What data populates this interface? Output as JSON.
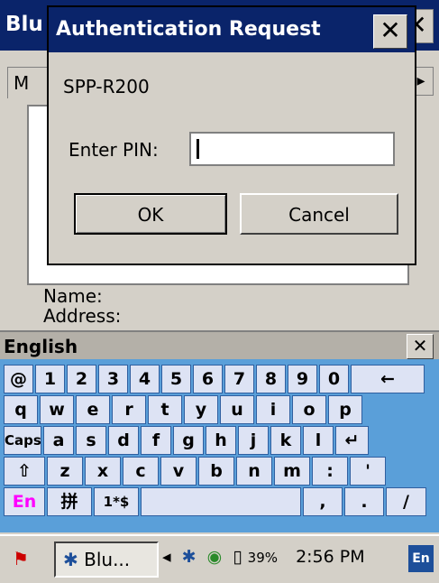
{
  "background_window": {
    "title": "Blu",
    "tab_label": "M",
    "scroll_arrow": "▸",
    "name_label": "Name:",
    "address_label": "Address:"
  },
  "dialog": {
    "title": "Authentication Request",
    "close_glyph": "✕",
    "device_name": "SPP-R200",
    "pin_label": "Enter PIN:",
    "pin_value": "",
    "ok_label": "OK",
    "cancel_label": "Cancel"
  },
  "keyboard": {
    "title": "English",
    "close_glyph": "✕",
    "rows": [
      [
        "@",
        "1",
        "2",
        "3",
        "4",
        "5",
        "6",
        "7",
        "8",
        "9",
        "0",
        "←"
      ],
      [
        "q",
        "w",
        "e",
        "r",
        "t",
        "y",
        "u",
        "i",
        "o",
        "p"
      ],
      [
        "Caps",
        "a",
        "s",
        "d",
        "f",
        "g",
        "h",
        "j",
        "k",
        "l",
        "↵"
      ],
      [
        "⇧",
        "z",
        "x",
        "c",
        "v",
        "b",
        "n",
        "m",
        ":",
        "'"
      ],
      [
        "En",
        "拼",
        "1*$",
        "",
        ",",
        ".",
        "/"
      ]
    ]
  },
  "taskbar": {
    "start_icon": "windows-flag-icon",
    "task_button_label": "Blu...",
    "battery_percent": "39%",
    "time": "2:56 PM",
    "input_indicator": "En"
  }
}
